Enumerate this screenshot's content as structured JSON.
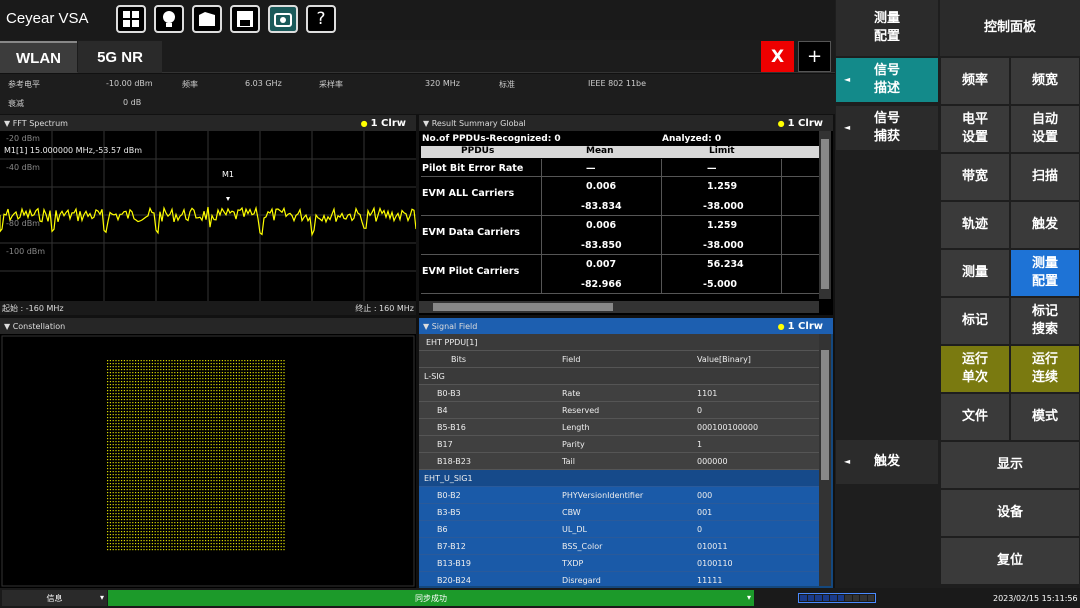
{
  "app": {
    "title": "Ceyear VSA"
  },
  "toolbar": {
    "icons": [
      "windows-icon",
      "bulb-icon",
      "folder-icon",
      "save-icon",
      "camera-icon",
      "help-icon"
    ],
    "help_label": "?"
  },
  "tabs": [
    {
      "label": "WLAN"
    },
    {
      "label": "5G NR"
    }
  ],
  "tab_actions": {
    "close": "X",
    "add": "+"
  },
  "params": {
    "ref_level_label": "参考电平",
    "ref_level_value": "-10.00 dBm",
    "freq_label": "频率",
    "freq_value": "6.03 GHz",
    "rate_label": "采样率",
    "rate_value": "320 MHz",
    "std_label": "标准",
    "std_value": "IEEE 802 11be",
    "atten_label": "衰减",
    "atten_value": "0 dB"
  },
  "fft": {
    "title": "FFT Spectrum",
    "trace": "1 Clrw",
    "marker_readout": "M1[1]     15.000000 MHz,-53.57 dBm",
    "marker_label": "M1",
    "y_labels": [
      "-20 dBm",
      "-40 dBm",
      "-80 dBm",
      "-100 dBm"
    ],
    "start": "起始 : -160 MHz",
    "stop": "终止 : 160 MHz"
  },
  "summary": {
    "title": "Result Summary Global",
    "trace": "1 Clrw",
    "recognized": "No.of PPDUs-Recognized:  0",
    "analyzed": "Analyzed:  0",
    "headers": [
      "PPDUs",
      "Mean",
      "Limit"
    ],
    "rows": [
      {
        "name": "Pilot Bit Error Rate",
        "mean": "—",
        "limit": "—",
        "mean2": "",
        "limit2": ""
      },
      {
        "name": "EVM ALL Carriers",
        "mean": "0.006",
        "limit": "1.259",
        "mean2": "-83.834",
        "limit2": "-38.000"
      },
      {
        "name": "EVM Data Carriers",
        "mean": "0.006",
        "limit": "1.259",
        "mean2": "-83.850",
        "limit2": "-38.000"
      },
      {
        "name": "EVM Pilot Carriers",
        "mean": "0.007",
        "limit": "56.234",
        "mean2": "-82.966",
        "limit2": "-5.000"
      }
    ]
  },
  "constellation": {
    "title": "Constellation"
  },
  "signal_field": {
    "title": "Signal Field",
    "trace": "1 Clrw",
    "group0": "EHT PPDU[1]",
    "headers": [
      "Bits",
      "Field",
      "Value[Binary]"
    ],
    "group1": "L-SIG",
    "lsig": [
      {
        "bits": "B0-B3",
        "field": "Rate",
        "value": "1101"
      },
      {
        "bits": "B4",
        "field": "Reserved",
        "value": "0"
      },
      {
        "bits": "B5-B16",
        "field": "Length",
        "value": "000100100000"
      },
      {
        "bits": "B17",
        "field": "Parity",
        "value": "1"
      },
      {
        "bits": "B18-B23",
        "field": "Tail",
        "value": "000000"
      }
    ],
    "group2": "EHT_U_SIG1",
    "usig": [
      {
        "bits": "B0-B2",
        "field": "PHYVersionIdentifier",
        "value": "000"
      },
      {
        "bits": "B3-B5",
        "field": "CBW",
        "value": "001"
      },
      {
        "bits": "B6",
        "field": "UL_DL",
        "value": "0"
      },
      {
        "bits": "B7-B12",
        "field": "BSS_Color",
        "value": "010011"
      },
      {
        "bits": "B13-B19",
        "field": "TXDP",
        "value": "0100110"
      },
      {
        "bits": "B20-B24",
        "field": "Disregard",
        "value": "11111"
      }
    ]
  },
  "side_menu": {
    "measure_config": "测量配置",
    "signal_desc": "信号描述",
    "signal_capture": "信号捕获",
    "trigger": "触发"
  },
  "control_panel": {
    "title": "控制面板",
    "buttons": [
      "频率",
      "频宽",
      "电平设置",
      "自动设置",
      "带宽",
      "扫描",
      "轨迹",
      "触发",
      "测量",
      "测量配置",
      "标记",
      "标记搜索",
      "运行单次",
      "运行连续",
      "文件",
      "模式",
      "显示",
      "设备",
      "复位"
    ]
  },
  "status": {
    "info": "信息",
    "message": "同步成功",
    "datetime": "2023/02/15 15:11:56"
  },
  "colors": {
    "trace": "#ffff00",
    "accent_teal": "#138a8a",
    "accent_blue": "#1e73d6",
    "sync_green": "#1c9a2a",
    "error_red": "#ee0000"
  }
}
